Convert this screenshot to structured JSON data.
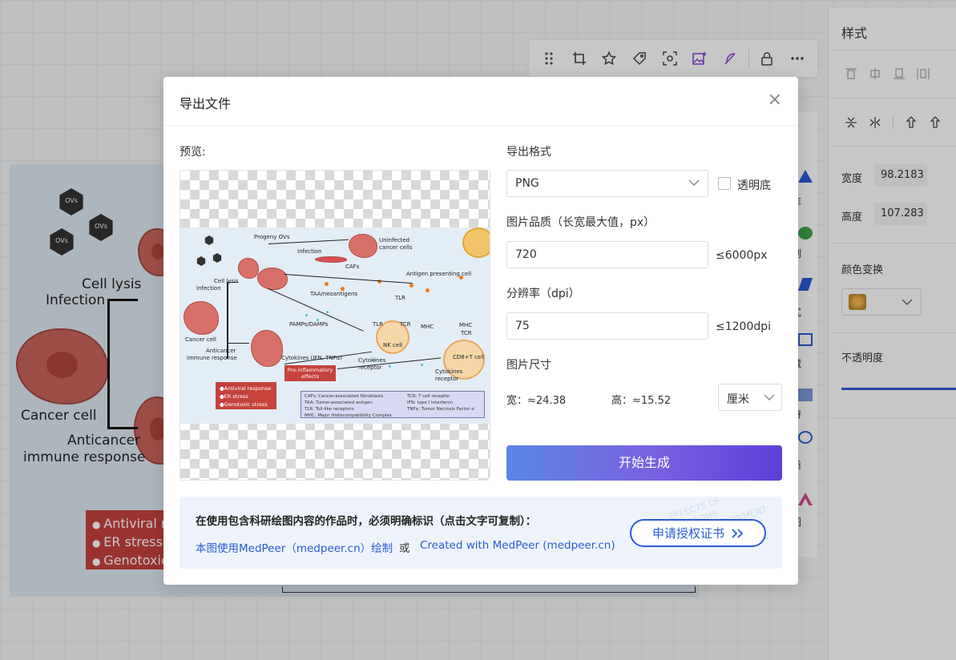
{
  "background": {
    "figure_labels": {
      "cell_lysis": "Cell lysis",
      "infection": "Infection",
      "cancer_cell": "Cancer cell",
      "anticancer": "Anticancer",
      "immune_response": "immune response",
      "ovs": "OVs"
    },
    "red_box_items": [
      "Antiviral r",
      "ER stress",
      "Genotoxic"
    ]
  },
  "right_panel": {
    "title": "样式",
    "width_label": "宽度",
    "width_value": "98.2183",
    "height_label": "高度",
    "height_value": "107.283",
    "color_transform_label": "颜色变换",
    "opacity_label": "不透明度"
  },
  "side_strip": {
    "items": [
      "库",
      "制",
      "式",
      "藏",
      "待",
      "质",
      "图"
    ]
  },
  "modal": {
    "title": "导出文件",
    "close": "×",
    "preview_label": "预览:",
    "format_label": "导出格式",
    "format_value": "PNG",
    "transparent_label": "透明底",
    "quality_label": "图片品质（长宽最大值，px）",
    "quality_value": "720",
    "quality_max": "≤6000px",
    "dpi_label": "分辨率（dpi）",
    "dpi_value": "75",
    "dpi_max": "≤1200dpi",
    "size_label": "图片尺寸",
    "width_text": "宽：≈24.38",
    "height_text": "高：≈15.52",
    "unit_value": "厘米",
    "generate_button": "开始生成",
    "notice": {
      "title": "在使用包含科研绘图内容的作品时，必须明确标识（点击文字可复制）：",
      "link1": "本图使用MedPeer（medpeer.cn）绘制",
      "or": "或",
      "link2": "Created with MedPeer (medpeer.cn)",
      "cert_button": "申请授权证书",
      "watermark": [
        "EFFECTS OF",
        "RIBOSOME",
        "MICROENVIRONMENT"
      ]
    }
  },
  "preview_figure": {
    "labels": {
      "progeny": "Progeny OVs",
      "infection": "Infection",
      "uninfected": "Uninfected",
      "cancer_cells": "cancer cells",
      "cafs": "CAFs",
      "cell_lysis": "Cell lysis",
      "infection2": "Infection",
      "apc": "Antigen presenting cell",
      "taa": "TAA/neoantigens",
      "tlr": "TLR",
      "pamps": "PAMPs/DAMPs",
      "tlr2": "TLR",
      "tcr": "TCR",
      "mhc": "MHC",
      "mhc2": "MHC",
      "tcr2": "TCR",
      "cancer_cell": "Cancer cell",
      "nk": "NK cell",
      "cd8": "CD8+T cell",
      "anticancer": "Anticancer",
      "immune_response": "immune response",
      "cytokines": "Cytokines (IFN, TNFα)",
      "receptor_label": "Cytokines",
      "receptor_label2": "receptor",
      "receptor_label3": "Cytokines",
      "receptor_label4": "receptor",
      "pro_inflammatory": "Pro-inflammatory",
      "effects": "effects"
    },
    "red_box_items": [
      "Antiviral response",
      "ER stress",
      "Genotoxic stress"
    ],
    "legend_left": [
      "CAFs: Cancer-associated fibroblasts",
      "TAA: Tumor-associated antigen",
      "TLR: Toll-like receptors",
      "MHC: Major Histocompatibility Complex"
    ],
    "legend_right": [
      "TCR: T cell receptor",
      "IFN: type I interferon",
      "TNFα: Tumor Necrosis Factor α"
    ]
  },
  "colors": {
    "accent": "#2b5cd6",
    "button_gradient_start": "#5b86e5",
    "button_gradient_end": "#5e3fd6",
    "red_box": "#c6423c"
  }
}
